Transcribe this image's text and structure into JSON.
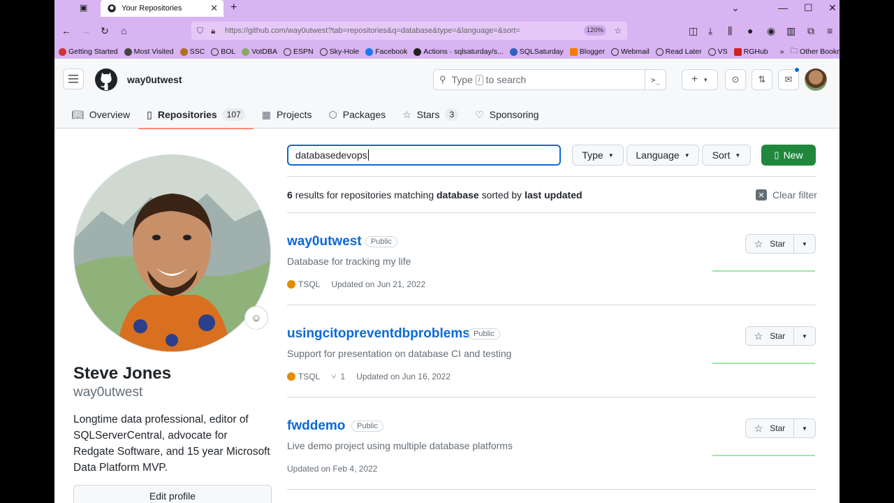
{
  "browser": {
    "tab_title": "Your Repositories",
    "url": "https://github.com/way0utwest?tab=repositories&q=database&type=&language=&sort=",
    "zoom": "120%",
    "bookmarks": [
      "Getting Started",
      "Most Visited",
      "SSC",
      "BOL",
      "VotDBA",
      "ESPN",
      "Sky-Hole",
      "Facebook",
      "Actions · sqlsaturday/s...",
      "SQLSaturday",
      "Blogger",
      "Webmail",
      "Read Later",
      "VS",
      "RGHub"
    ],
    "other_bookmarks": "Other Bookmarks"
  },
  "header": {
    "username": "way0utwest",
    "search_prefix": "Type",
    "search_key": "/",
    "search_suffix": "to search"
  },
  "tabs": [
    {
      "label": "Overview"
    },
    {
      "label": "Repositories",
      "count": "107"
    },
    {
      "label": "Projects"
    },
    {
      "label": "Packages"
    },
    {
      "label": "Stars",
      "count": "3"
    },
    {
      "label": "Sponsoring"
    }
  ],
  "profile": {
    "name": "Steve Jones",
    "login": "way0utwest",
    "bio": "Longtime data professional, editor of SQLServerCentral, advocate for Redgate Software, and 15 year Microsoft Data Platform MVP.",
    "edit_label": "Edit profile"
  },
  "filters": {
    "query": "databasedevops",
    "type_label": "Type",
    "language_label": "Language",
    "sort_label": "Sort",
    "new_label": "New"
  },
  "results": {
    "count": "6",
    "text1": "results for repositories matching",
    "term": "database",
    "text2": "sorted by",
    "sort": "last updated",
    "clear_label": "Clear filter"
  },
  "repos": [
    {
      "name": "way0utwest",
      "visibility": "Public",
      "description": "Database for tracking my life",
      "language": "TSQL",
      "forks": "",
      "updated": "Updated on Jun 21, 2022",
      "star_label": "Star"
    },
    {
      "name": "usingcitopreventdbproblems",
      "visibility": "Public",
      "description": "Support for presentation on database CI and testing",
      "language": "TSQL",
      "forks": "1",
      "updated": "Updated on Jun 16, 2022",
      "star_label": "Star"
    },
    {
      "name": "fwddemo",
      "visibility": "Public",
      "description": "Live demo project using multiple database platforms",
      "language": "",
      "forks": "",
      "updated": "Updated on Feb 4, 2022",
      "star_label": "Star"
    }
  ],
  "colors": {
    "accent": "#0969da",
    "new_button": "#1f883d",
    "tab_underline": "#fd8c73",
    "tsql": "#e38c00",
    "browser_chrome": "#d8b4f2"
  }
}
